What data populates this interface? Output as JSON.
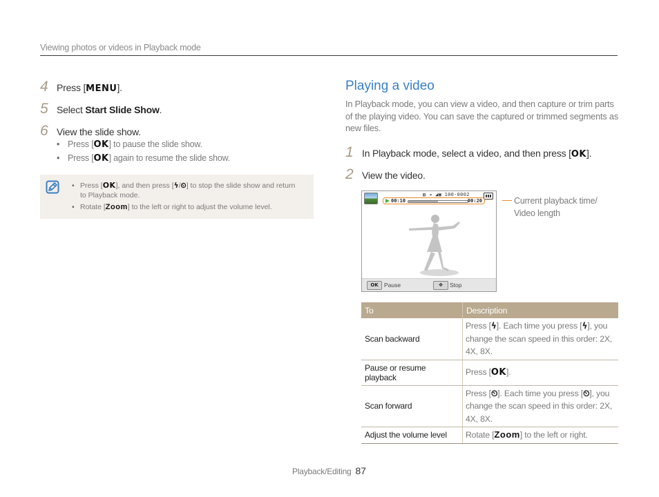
{
  "header": {
    "section": "Viewing photos or videos in Playback mode"
  },
  "left": {
    "steps": [
      {
        "num": "4",
        "pre": "Press [",
        "key": "MENU",
        "post": "]."
      },
      {
        "num": "5",
        "pre": "Select ",
        "bold": "Start Slide Show",
        "post": "."
      },
      {
        "num": "6",
        "text": "View the slide show."
      }
    ],
    "step6_bullets": [
      {
        "pre": "Press [",
        "key": "OK",
        "post": "] to pause the slide show."
      },
      {
        "pre": "Press [",
        "key": "OK",
        "post": "] again to resume the slide show."
      }
    ],
    "note": {
      "icon": "note-pencil-icon",
      "bullets": [
        {
          "pre": "Press [",
          "key": "OK",
          "mid": "], and then press [",
          "icons": "flash-icon / timer-icon",
          "post": "] to stop the slide show and return to Playback mode."
        },
        {
          "pre": "Rotate [",
          "key": "Zoom",
          "post": "] to the left or right to adjust the volume level."
        }
      ]
    }
  },
  "right": {
    "title": "Playing a video",
    "intro": "In Playback mode, you can view a video, and then capture or trim parts of the playing video. You can save the captured or trimmed segments as new files.",
    "steps": [
      {
        "num": "1",
        "pre": "In Playback mode, select a video, and then press [",
        "key": "OK",
        "post": "]."
      },
      {
        "num": "2",
        "text": "View the video."
      }
    ],
    "screen": {
      "status_text": "100-0002",
      "current_time": "00:10",
      "video_length": "00:20",
      "progress_fraction": 0.5,
      "ok_key": "OK",
      "ok_label": "Pause",
      "stop_label": "Stop"
    },
    "callout": {
      "line1": "Current playback time/",
      "line2": "Video length"
    },
    "table": {
      "headers": [
        "To",
        "Description"
      ],
      "rows": [
        {
          "to": "Scan backward",
          "desc_pre": "Press [",
          "icon": "flash-icon",
          "desc_mid": "]. Each time you press [",
          "desc_post": "], you change the scan speed in this order: 2X, 4X, 8X."
        },
        {
          "to": "Pause or resume playback",
          "desc_pre": "Press [",
          "key": "OK",
          "desc_post": "]."
        },
        {
          "to": "Scan forward",
          "desc_pre": "Press [",
          "icon": "timer-icon",
          "desc_mid": "]. Each time you press [",
          "desc_post": "], you change the scan speed in this order: 2X, 4X, 8X."
        },
        {
          "to": "Adjust the volume level",
          "desc_pre": "Rotate [",
          "key": "Zoom",
          "desc_post": "] to the left or right."
        }
      ]
    }
  },
  "footer": {
    "section": "Playback/Editing",
    "page": "87"
  },
  "colors": {
    "accent_blue": "#3a7fc4",
    "step_num": "#a89a85",
    "table_header": "#b9a98f",
    "callout_orange": "#e88a2e",
    "note_bg": "#f3efea"
  }
}
